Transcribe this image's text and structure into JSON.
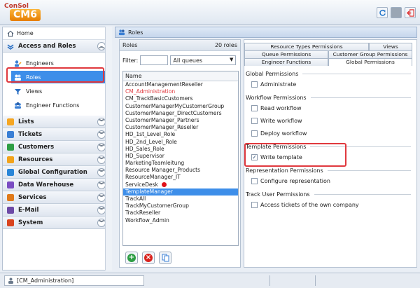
{
  "app": {
    "logo_top": "ConSol",
    "logo_main": "CM6"
  },
  "toolbar": {
    "refresh_icon": "refresh-icon",
    "logout_icon": "logout-icon"
  },
  "sidebar": {
    "home": "Home",
    "access_section": "Access and Roles",
    "access_items": [
      {
        "label": "Engineers",
        "icon": "engineers-icon"
      },
      {
        "label": "Roles",
        "icon": "roles-icon"
      },
      {
        "label": "Views",
        "icon": "views-icon"
      },
      {
        "label": "Engineer Functions",
        "icon": "engineer-functions-icon"
      }
    ],
    "sections": [
      {
        "label": "Lists",
        "icon": "lists-icon",
        "color": "#f5a623"
      },
      {
        "label": "Tickets",
        "icon": "tickets-icon",
        "color": "#3a7fd5"
      },
      {
        "label": "Customers",
        "icon": "customers-icon",
        "color": "#2e9e44"
      },
      {
        "label": "Resources",
        "icon": "resources-icon",
        "color": "#f2a31b"
      },
      {
        "label": "Global Configuration",
        "icon": "globe-icon",
        "color": "#2a86d8"
      },
      {
        "label": "Data Warehouse",
        "icon": "data-warehouse-icon",
        "color": "#7a4cc2"
      },
      {
        "label": "Services",
        "icon": "services-icon",
        "color": "#e07a1b"
      },
      {
        "label": "E-Mail",
        "icon": "email-icon",
        "color": "#6d4aa6"
      },
      {
        "label": "System",
        "icon": "system-icon",
        "color": "#d9431e"
      }
    ]
  },
  "main": {
    "title": "Roles"
  },
  "roles": {
    "header": "Roles",
    "count": "20 roles",
    "filter_label": "Filter:",
    "filter_value": "",
    "queue_select": "All queues",
    "column_header": "Name",
    "items": [
      "AccountManagementReseller",
      "CM_Administration",
      "CM_TrackBasicCustomers",
      "CustomerManagerMyCustomerGroup",
      "CustomerManager_DirectCustomers",
      "CustomerManager_Partners",
      "CustomerManager_Reseller",
      "HD_1st_Level_Role",
      "HD_2nd_Level_Role",
      "HD_Sales_Role",
      "HD_Supervisor",
      "MarketingTeamleitung",
      "Resource Manager_Products",
      "ResourceManager_IT",
      "ServiceDesk",
      "TemplateManager",
      "TrackAll",
      "TrackMyCustomerGroup",
      "TrackReseller",
      "Workflow_Admin"
    ],
    "selected": "TemplateManager",
    "highlighted": "CM_Administration"
  },
  "tabs": {
    "row1": [
      "Resource Types Permissions",
      "Views"
    ],
    "row2": [
      "Queue Permissions",
      "Customer Group Permissions"
    ],
    "row3": [
      "Engineer Functions",
      "Global Permissions"
    ],
    "active": "Global Permissions"
  },
  "permissions": [
    {
      "group": "Global Permissions",
      "items": [
        {
          "label": "Administrate",
          "checked": false
        }
      ]
    },
    {
      "group": "Workflow Permissions",
      "items": [
        {
          "label": "Read workflow",
          "checked": false
        },
        {
          "label": "Write workflow",
          "checked": false
        },
        {
          "label": "Deploy workflow",
          "checked": false
        }
      ]
    },
    {
      "group": "Template Permissions",
      "items": [
        {
          "label": "Write template",
          "checked": true
        }
      ]
    },
    {
      "group": "Representation Permissions",
      "items": [
        {
          "label": "Configure representation",
          "checked": false
        }
      ]
    },
    {
      "group": "Track User Permissions",
      "items": [
        {
          "label": "Access tickets of the own company",
          "checked": false
        }
      ]
    }
  ],
  "status": {
    "user": "[CM_Administration]"
  },
  "colors": {
    "accent": "#3d8ee9",
    "highlight_box": "#e0393e",
    "red_text": "#e0393e"
  }
}
